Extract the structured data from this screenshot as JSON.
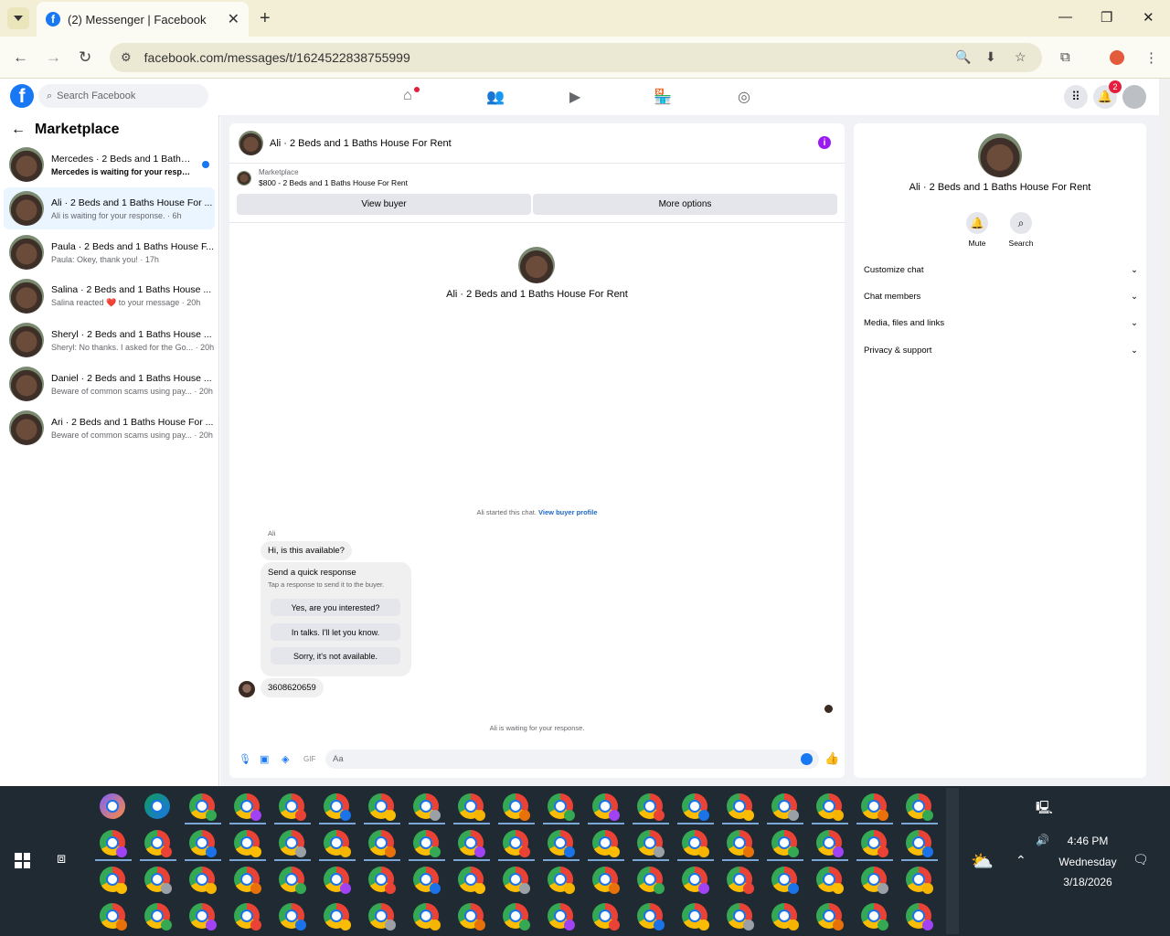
{
  "browser": {
    "tab_title": "(2) Messenger | Facebook",
    "url": "facebook.com/messages/t/1624522838755999"
  },
  "facebook": {
    "search_placeholder": "Search Facebook",
    "notification_count": "2"
  },
  "sidebar": {
    "title": "Marketplace",
    "conversations": [
      {
        "name": "Mercedes · 2 Beds and 1 Baths H...",
        "preview": "Mercedes is waiting for your respo... · 5h",
        "unread": true
      },
      {
        "name": "Ali · 2 Beds and 1 Baths House For ...",
        "preview": "Ali is waiting for your response. · 6h",
        "active": true
      },
      {
        "name": "Paula · 2 Beds and 1 Baths House F...",
        "preview": "Paula: Okey, thank you! · 17h"
      },
      {
        "name": "Salina · 2 Beds and 1 Baths House ...",
        "preview": "Salina reacted ❤️ to your message · 20h"
      },
      {
        "name": "Sheryl · 2 Beds and 1 Baths House ...",
        "preview": "Sheryl: No thanks. I asked for the Go... · 20h"
      },
      {
        "name": "Daniel · 2 Beds and 1 Baths House ...",
        "preview": "Beware of common scams using pay... · 20h"
      },
      {
        "name": "Ari · 2 Beds and 1 Baths House For ...",
        "preview": "Beware of common scams using pay... · 20h"
      }
    ]
  },
  "chat": {
    "header_name": "Ali · 2 Beds and 1 Baths House For Rent",
    "marketplace_label": "Marketplace",
    "listing": "$800 - 2 Beds and 1 Baths House For Rent",
    "view_buyer": "View buyer",
    "more_options": "More options",
    "center_name": "Ali · 2 Beds and 1 Baths House For Rent",
    "started_text": "Ali started this chat.",
    "view_buyer_profile": "View buyer profile",
    "sender": "Ali",
    "message1": "Hi, is this available?",
    "quick_title": "Send a quick response",
    "quick_sub": "Tap a response to send it to the buyer.",
    "quick_responses": [
      "Yes, are you interested?",
      "In talks. I'll let you know.",
      "Sorry, it's not available."
    ],
    "message2": "3608620659",
    "waiting_text": "Ali is waiting for your response.",
    "composer_placeholder": "Aa"
  },
  "right_panel": {
    "name": "Ali · 2 Beds and 1 Baths House For Rent",
    "mute": "Mute",
    "search": "Search",
    "sections": [
      "Customize chat",
      "Chat members",
      "Media, files and links",
      "Privacy & support"
    ]
  },
  "taskbar": {
    "time": "4:46 PM",
    "day": "Wednesday",
    "date": "3/18/2026"
  }
}
